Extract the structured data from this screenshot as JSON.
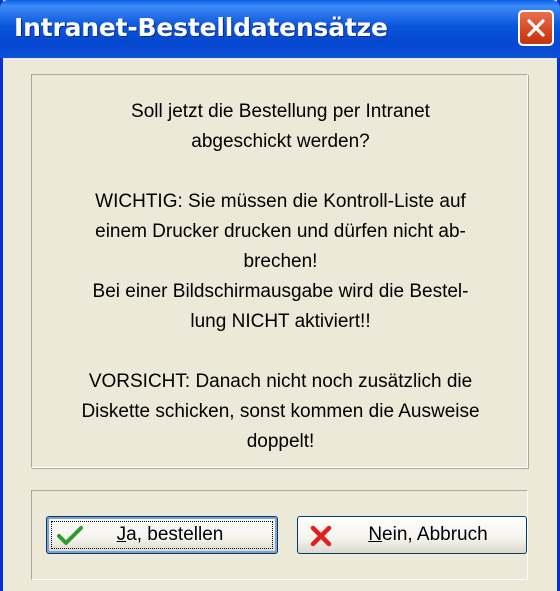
{
  "window": {
    "title": "Intranet-Bestelldatensätze"
  },
  "message": {
    "paragraph1": "Soll jetzt die Bestellung per Intranet\nabgeschickt werden?",
    "paragraph2": "WICHTIG: Sie müssen die Kontroll-Liste auf\neinem Drucker drucken und dürfen nicht ab-\nbrechen!\nBei einer Bildschirmausgabe wird die Bestel-\nlung NICHT aktiviert!!",
    "paragraph3": "VORSICHT: Danach nicht noch zusätzlich die\nDiskette schicken, sonst kommen die Ausweise\ndoppelt!"
  },
  "buttons": {
    "yes_label": "Ja, bestellen",
    "no_label": "Nein, Abbruch"
  },
  "icons": {
    "close": "close-icon",
    "yes": "checkmark-icon",
    "no": "cross-icon"
  },
  "colors": {
    "titlebar": "#0a55dd",
    "close_button": "#d44520",
    "checkmark": "#2e9b2e",
    "cross": "#e02020",
    "background": "#ece9d8"
  }
}
